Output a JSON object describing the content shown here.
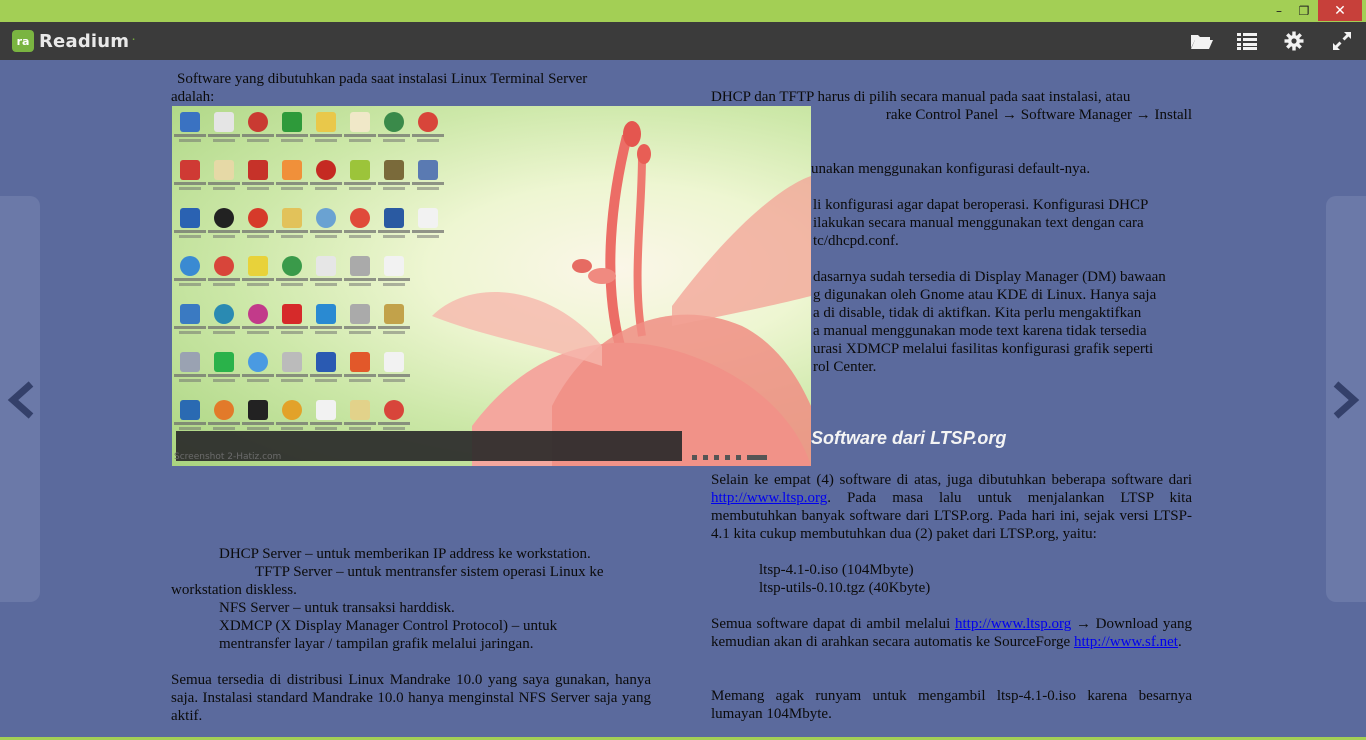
{
  "window": {
    "minimize": "–",
    "maximize": "❐",
    "close": "✕"
  },
  "app": {
    "logo_mark": "ra",
    "name": "Readium",
    "colors": {
      "titlebar": "#a3cf55",
      "appbar": "#3b3b3b",
      "page": "#5b6a9d",
      "close": "#c7403a"
    }
  },
  "toolbar": {
    "icons": [
      "open-library-icon",
      "table-of-contents-icon",
      "settings-icon",
      "fullscreen-icon"
    ]
  },
  "left_column": {
    "intro_line1": "Software yang dibutuhkan pada saat instalasi Linux Terminal Server",
    "intro_line2": "adalah:",
    "list": [
      "DHCP Server – untuk memberikan IP address ke workstation.",
      "TFTP Server – untuk mentransfer sistem operasi Linux ke",
      "workstation diskless.",
      "NFS Server – untuk transaksi harddisk.",
      "XDMCP (X Display Manager Control Protocol) – untuk",
      "mentransfer layar / tampilan grafik melalui jaringan."
    ],
    "para2": "Semua tersedia di distribusi Linux Mandrake 10.0 yang saya gunakan, hanya saja. Instalasi standard Mandrake 10.0 hanya menginstal NFS Server saja yang aktif."
  },
  "screenshot": {
    "watermark": "Screenshot 2-Hatiz.com"
  },
  "right_column": {
    "p1_line1": "DHCP dan TFTP harus di pilih secara manual pada saat instalasi, atau",
    "p1_line2": "rake Control Panel → Software Manager → Install",
    "p2": "unakan menggunakan konfigurasi default-nya.",
    "p3_lines": [
      "li konfigurasi agar dapat beroperasi. Konfigurasi DHCP",
      "ilakukan secara manual menggunakan text dengan cara",
      "tc/dhcpd.conf."
    ],
    "p4_lines": [
      "dasarnya sudah tersedia di Display Manager (DM) bawaan",
      "g digunakan oleh Gnome atau KDE di Linux. Hanya saja",
      "a di disable, tidak di aktifkan. Kita perlu mengaktifkan",
      "a manual menggunakan mode text karena tidak tersedia",
      "urasi XDMCP melalui fasilitas konfigurasi grafik seperti",
      "rol Center."
    ],
    "heading": "Software dari LTSP.org",
    "p5_a": "Selain ke empat (4) software di atas, juga dibutuhkan beberapa software dari ",
    "p5_link": "http://www.ltsp.org",
    "p5_b": ". Pada masa lalu untuk menjalankan LTSP kita membutuhkan banyak software dari LTSP.org. Pada hari ini, sejak versi LTSP-4.1 kita cukup membutuhkan dua (2) paket dari LTSP.org, yaitu:",
    "packages": [
      "ltsp-4.1-0.iso (104Mbyte)",
      "ltsp-utils-0.10.tgz (40Kbyte)"
    ],
    "p6_a": "Semua software dapat di ambil melalui ",
    "p6_link1": "http://www.ltsp.org",
    "p6_b": " → Download yang kemudian akan di arahkan secara automatis ke SourceForge ",
    "p6_link2": "http://www.sf.net",
    "p6_c": ".",
    "p7": "Memang agak runyam untuk mengambil ltsp-4.1-0.iso karena besarnya lumayan 104Mbyte."
  },
  "nav": {
    "prev": "previous-page-icon",
    "next": "next-page-icon"
  }
}
